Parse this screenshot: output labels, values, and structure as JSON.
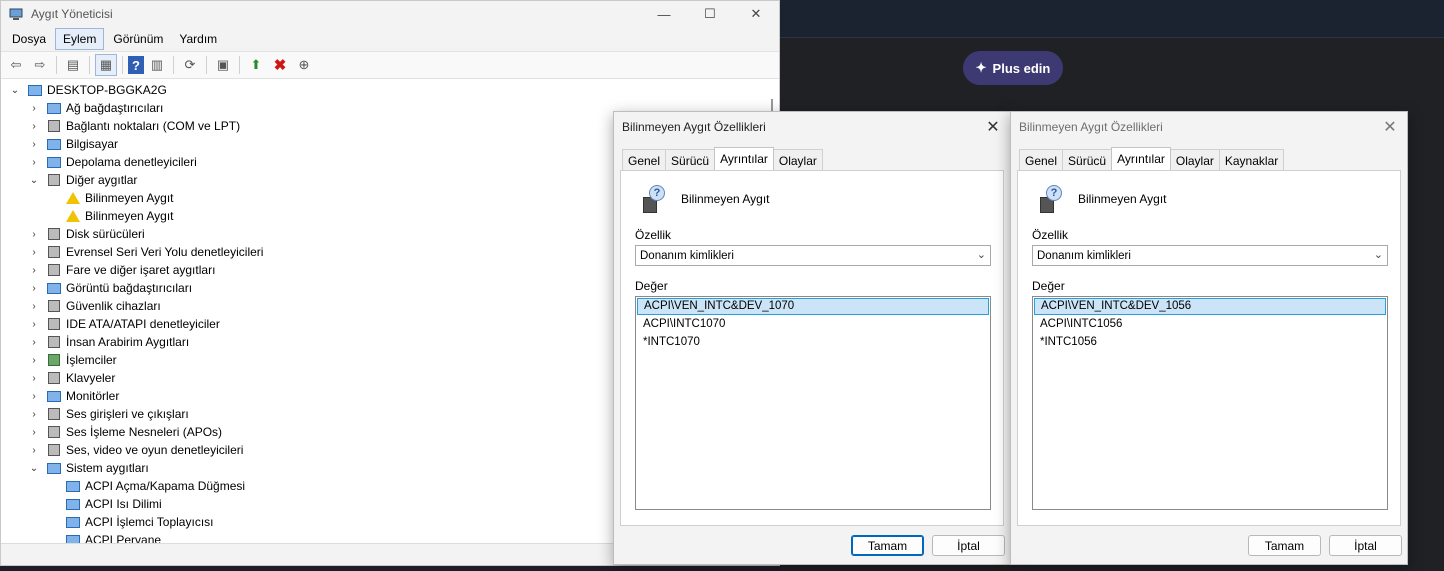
{
  "background_app": {
    "plus_button_label": "Plus edin",
    "spark_icon": "sparkle-icon"
  },
  "device_manager": {
    "title": "Aygıt Yöneticisi",
    "window_controls": {
      "minimize": "—",
      "maximize": "☐",
      "close": "✕"
    },
    "menu": [
      "Dosya",
      "Eylem",
      "Görünüm",
      "Yardım"
    ],
    "active_menu": "Eylem",
    "tree": [
      {
        "label": "DESKTOP-BGGKA2G",
        "level": 0,
        "expander": "⌄",
        "icon": "computer-icon"
      },
      {
        "label": "Ağ bağdaştırıcıları",
        "level": 1,
        "expander": "›",
        "icon": "network-icon"
      },
      {
        "label": "Bağlantı noktaları (COM ve LPT)",
        "level": 1,
        "expander": "›",
        "icon": "port-icon"
      },
      {
        "label": "Bilgisayar",
        "level": 1,
        "expander": "›",
        "icon": "monitor-icon"
      },
      {
        "label": "Depolama denetleyicileri",
        "level": 1,
        "expander": "›",
        "icon": "storage-icon"
      },
      {
        "label": "Diğer aygıtlar",
        "level": 1,
        "expander": "⌄",
        "icon": "other-devices-icon"
      },
      {
        "label": "Bilinmeyen Aygıt",
        "level": 2,
        "expander": "",
        "icon": "warning-icon"
      },
      {
        "label": "Bilinmeyen Aygıt",
        "level": 2,
        "expander": "",
        "icon": "warning-icon"
      },
      {
        "label": "Disk sürücüleri",
        "level": 1,
        "expander": "›",
        "icon": "disk-icon"
      },
      {
        "label": "Evrensel Seri Veri Yolu denetleyicileri",
        "level": 1,
        "expander": "›",
        "icon": "usb-icon"
      },
      {
        "label": "Fare ve diğer işaret aygıtları",
        "level": 1,
        "expander": "›",
        "icon": "mouse-icon"
      },
      {
        "label": "Görüntü bağdaştırıcıları",
        "level": 1,
        "expander": "›",
        "icon": "display-adapter-icon"
      },
      {
        "label": "Güvenlik cihazları",
        "level": 1,
        "expander": "›",
        "icon": "security-icon"
      },
      {
        "label": "IDE ATA/ATAPI denetleyiciler",
        "level": 1,
        "expander": "›",
        "icon": "ide-icon"
      },
      {
        "label": "İnsan Arabirim Aygıtları",
        "level": 1,
        "expander": "›",
        "icon": "hid-icon"
      },
      {
        "label": "İşlemciler",
        "level": 1,
        "expander": "›",
        "icon": "processor-icon"
      },
      {
        "label": "Klavyeler",
        "level": 1,
        "expander": "›",
        "icon": "keyboard-icon"
      },
      {
        "label": "Monitörler",
        "level": 1,
        "expander": "›",
        "icon": "monitor-icon"
      },
      {
        "label": "Ses girişleri ve çıkışları",
        "level": 1,
        "expander": "›",
        "icon": "speaker-icon"
      },
      {
        "label": "Ses İşleme Nesneleri (APOs)",
        "level": 1,
        "expander": "›",
        "icon": "speaker-icon"
      },
      {
        "label": "Ses, video ve oyun denetleyicileri",
        "level": 1,
        "expander": "›",
        "icon": "speaker-icon"
      },
      {
        "label": "Sistem aygıtları",
        "level": 1,
        "expander": "⌄",
        "icon": "system-icon"
      },
      {
        "label": "ACPI Açma/Kapama Düğmesi",
        "level": 2,
        "expander": "",
        "icon": "system-device-icon"
      },
      {
        "label": "ACPI Isı Dilimi",
        "level": 2,
        "expander": "",
        "icon": "system-device-icon"
      },
      {
        "label": "ACPI İşlemci Toplayıcısı",
        "level": 2,
        "expander": "",
        "icon": "system-device-icon"
      },
      {
        "label": "ACPI Pervane",
        "level": 2,
        "expander": "",
        "icon": "system-device-icon"
      }
    ]
  },
  "dialogs": [
    {
      "title": "Bilinmeyen Aygıt Özellikleri",
      "tabs": [
        "Genel",
        "Sürücü",
        "Ayrıntılar",
        "Olaylar"
      ],
      "active_tab": "Ayrıntılar",
      "device_name": "Bilinmeyen Aygıt",
      "property_label": "Özellik",
      "property_value": "Donanım kimlikleri",
      "value_label": "Değer",
      "values": [
        "ACPI\\VEN_INTC&DEV_1070",
        "ACPI\\INTC1070",
        "*INTC1070"
      ],
      "ok": "Tamam",
      "cancel": "İptal"
    },
    {
      "title": "Bilinmeyen Aygıt Özellikleri",
      "tabs": [
        "Genel",
        "Sürücü",
        "Ayrıntılar",
        "Olaylar",
        "Kaynaklar"
      ],
      "active_tab": "Ayrıntılar",
      "device_name": "Bilinmeyen Aygıt",
      "property_label": "Özellik",
      "property_value": "Donanım kimlikleri",
      "value_label": "Değer",
      "values": [
        "ACPI\\VEN_INTC&DEV_1056",
        "ACPI\\INTC1056",
        "*INTC1056"
      ],
      "ok": "Tamam",
      "cancel": "İptal"
    }
  ]
}
